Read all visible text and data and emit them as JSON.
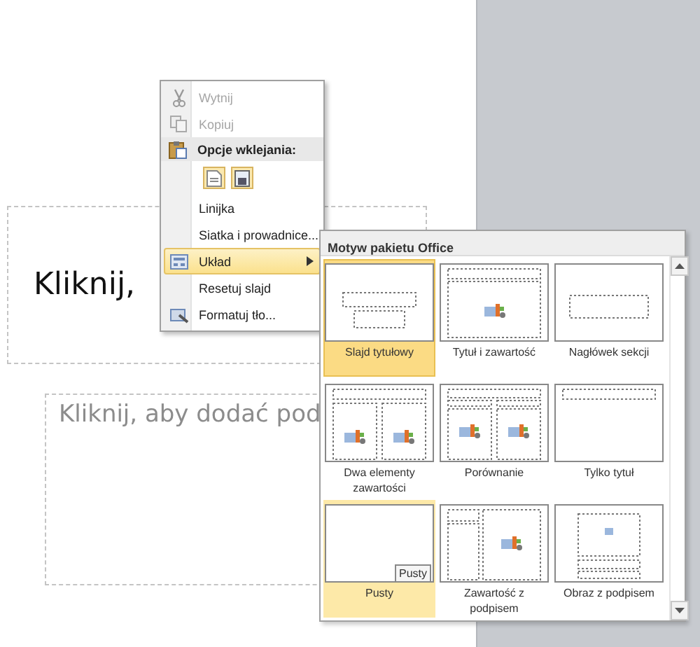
{
  "slide": {
    "title_placeholder": "Kliknij,",
    "subtitle_placeholder": "Kliknij, aby dodać pod"
  },
  "context_menu": {
    "items": [
      {
        "kind": "item",
        "label": "Wytnij",
        "disabled": true
      },
      {
        "kind": "item",
        "label": "Kopiuj",
        "disabled": true
      },
      {
        "kind": "header",
        "label": "Opcje wklejania:"
      },
      {
        "kind": "paste-options"
      },
      {
        "kind": "item",
        "label": "Linijka",
        "disabled": false
      },
      {
        "kind": "item",
        "label": "Siatka i prowadnice...",
        "disabled": false
      },
      {
        "kind": "submenu",
        "label": "Układ",
        "disabled": false,
        "selected": true
      },
      {
        "kind": "item",
        "label": "Resetuj slajd",
        "disabled": false
      },
      {
        "kind": "item",
        "label": "Formatuj tło...",
        "disabled": false
      }
    ]
  },
  "layout_gallery": {
    "title": "Motyw pakietu Office",
    "layouts": [
      {
        "kind": "title",
        "label": "Slajd tytułowy",
        "selected": true,
        "hovered": false
      },
      {
        "kind": "title-content",
        "label": "Tytuł i zawartość",
        "selected": false,
        "hovered": false
      },
      {
        "kind": "section",
        "label": "Nagłówek sekcji",
        "selected": false,
        "hovered": false
      },
      {
        "kind": "two-content",
        "label": "Dwa elementy zawartości",
        "selected": false,
        "hovered": false
      },
      {
        "kind": "comparison",
        "label": "Porównanie",
        "selected": false,
        "hovered": false
      },
      {
        "kind": "title-only",
        "label": "Tylko tytuł",
        "selected": false,
        "hovered": false
      },
      {
        "kind": "blank",
        "label": "Pusty",
        "selected": false,
        "hovered": true,
        "tooltip": "Pusty"
      },
      {
        "kind": "content-caption",
        "label": "Zawartość z podpisem",
        "selected": false,
        "hovered": false
      },
      {
        "kind": "picture-caption",
        "label": "Obraz z podpisem",
        "selected": false,
        "hovered": false
      }
    ]
  }
}
